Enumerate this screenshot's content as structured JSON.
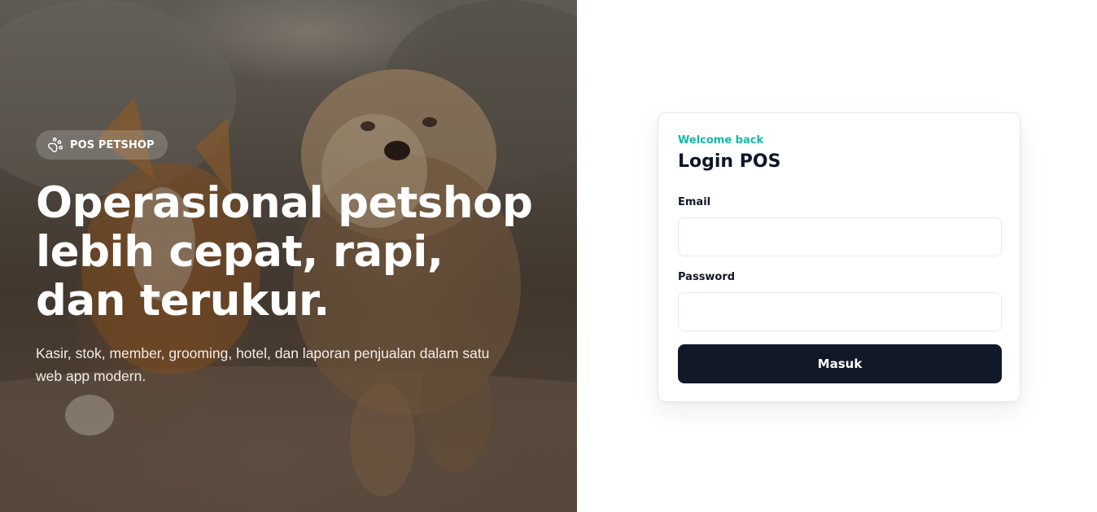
{
  "hero": {
    "brand": "POS PETSHOP",
    "brand_icon": "paw-icon",
    "headline": {
      "line1": "Operasional petshop",
      "line2": "lebih cepat, rapi,",
      "line3": "dan terukur."
    },
    "subtext": "Kasir, stok, member, grooming, hotel, dan laporan penjualan dalam satu web app modern."
  },
  "login": {
    "welcome": "Welcome back",
    "title": "Login POS",
    "email_label": "Email",
    "email_value": "",
    "password_label": "Password",
    "password_value": "",
    "submit_label": "Masuk"
  },
  "colors": {
    "accent": "#14b8a6",
    "button": "#111827",
    "title": "#0f172a"
  }
}
